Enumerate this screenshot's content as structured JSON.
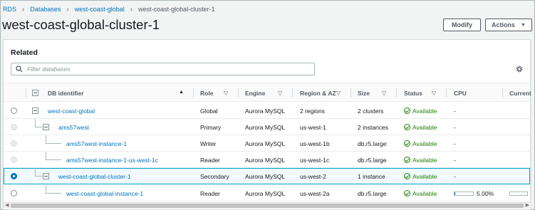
{
  "breadcrumb": {
    "items": [
      "RDS",
      "Databases",
      "west-coast-global"
    ],
    "current": "west-coast-global-cluster-1"
  },
  "page_title": "west-coast-global-cluster-1",
  "buttons": {
    "modify": "Modify",
    "actions": "Actions"
  },
  "related": {
    "heading": "Related",
    "search_placeholder": "Filter databases"
  },
  "table": {
    "columns": [
      "DB identifier",
      "Role",
      "Engine",
      "Region & AZ",
      "Size",
      "Status",
      "CPU",
      "Current"
    ],
    "rows": [
      {
        "id": "west-coast-global",
        "role": "Global",
        "engine": "Aurora MySQL",
        "region": "2 regions",
        "size": "2 clusters",
        "status": "Available",
        "cpu": "-"
      },
      {
        "id": "ams57west",
        "role": "Primary",
        "engine": "Aurora MySQL",
        "region": "us-west-1",
        "size": "2 instances",
        "status": "Available",
        "cpu": "-"
      },
      {
        "id": "ams57west-instance-1",
        "role": "Writer",
        "engine": "Aurora MySQL",
        "region": "us-west-1b",
        "size": "db.r5.large",
        "status": "Available",
        "cpu": "-"
      },
      {
        "id": "ams57west-instance-1-us-west-1c",
        "role": "Reader",
        "engine": "Aurora MySQL",
        "region": "us-west-1c",
        "size": "db.r5.large",
        "status": "Available",
        "cpu": "-"
      },
      {
        "id": "west-coast-global-cluster-1",
        "role": "Secondary",
        "engine": "Aurora MySQL",
        "region": "us-west-2",
        "size": "1 instance",
        "status": "Available",
        "cpu": "-"
      },
      {
        "id": "west-coast-global-instance-1",
        "role": "Reader",
        "engine": "Aurora MySQL",
        "region": "us-west-2a",
        "size": "db.r5.large",
        "status": "Available",
        "cpu": "5.00%",
        "cpu_fraction": 0.05
      }
    ]
  },
  "colors": {
    "link": "#0073bb",
    "available": "#1d8102",
    "selected_border": "#00a1c9"
  },
  "icons": [
    "chevron-right-icon",
    "search-icon",
    "gear-icon",
    "caret-down-icon",
    "sort-asc-icon",
    "filter-icon",
    "collapse-icon",
    "status-ok-icon"
  ]
}
